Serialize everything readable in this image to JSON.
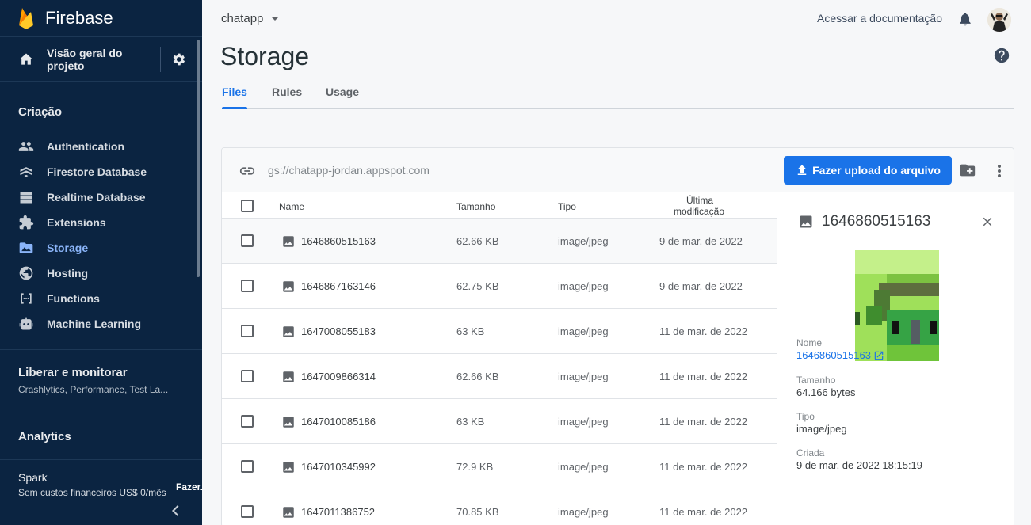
{
  "sidebar": {
    "brand": "Firebase",
    "overview": "Visão geral do projeto",
    "section_build": "Criação",
    "items": [
      {
        "label": "Authentication",
        "icon": "people-icon"
      },
      {
        "label": "Firestore Database",
        "icon": "firestore-icon"
      },
      {
        "label": "Realtime Database",
        "icon": "database-icon"
      },
      {
        "label": "Extensions",
        "icon": "puzzle-icon"
      },
      {
        "label": "Storage",
        "icon": "photo-folder-icon",
        "active": true
      },
      {
        "label": "Hosting",
        "icon": "globe-icon"
      },
      {
        "label": "Functions",
        "icon": "functions-icon"
      },
      {
        "label": "Machine Learning",
        "icon": "robot-icon"
      }
    ],
    "release_title": "Liberar e monitorar",
    "release_sub": "Crashlytics, Performance, Test La...",
    "analytics": "Analytics",
    "plan_name": "Spark",
    "plan_cost": "Sem custos financeiros US$ 0/mês",
    "upgrade": "Fazer..."
  },
  "header": {
    "project": "chatapp",
    "docs": "Acessar a documentação",
    "title": "Storage"
  },
  "tabs": [
    "Files",
    "Rules",
    "Usage"
  ],
  "toolbar": {
    "bucket": "gs://chatapp-jordan.appspot.com",
    "upload": "Fazer upload do arquivo"
  },
  "table": {
    "headers": {
      "name": "Name",
      "size": "Tamanho",
      "type": "Tipo",
      "modified_1": "Última",
      "modified_2": "modificação"
    },
    "rows": [
      {
        "name": "1646860515163",
        "size": "62.66 KB",
        "type": "image/jpeg",
        "date": "9 de mar. de 2022"
      },
      {
        "name": "1646867163146",
        "size": "62.75 KB",
        "type": "image/jpeg",
        "date": "9 de mar. de 2022"
      },
      {
        "name": "1647008055183",
        "size": "63 KB",
        "type": "image/jpeg",
        "date": "11 de mar. de 2022"
      },
      {
        "name": "1647009866314",
        "size": "62.66 KB",
        "type": "image/jpeg",
        "date": "11 de mar. de 2022"
      },
      {
        "name": "1647010085186",
        "size": "63 KB",
        "type": "image/jpeg",
        "date": "11 de mar. de 2022"
      },
      {
        "name": "1647010345992",
        "size": "72.9 KB",
        "type": "image/jpeg",
        "date": "11 de mar. de 2022"
      },
      {
        "name": "1647011386752",
        "size": "70.85 KB",
        "type": "image/jpeg",
        "date": "11 de mar. de 2022"
      }
    ]
  },
  "detail": {
    "title": "1646860515163",
    "name_label": "Nome",
    "name_value": "1646860515163",
    "size_label": "Tamanho",
    "size_value": "64.166 bytes",
    "type_label": "Tipo",
    "type_value": "image/jpeg",
    "created_label": "Criada",
    "created_value": "9 de mar. de 2022 18:15:19"
  }
}
